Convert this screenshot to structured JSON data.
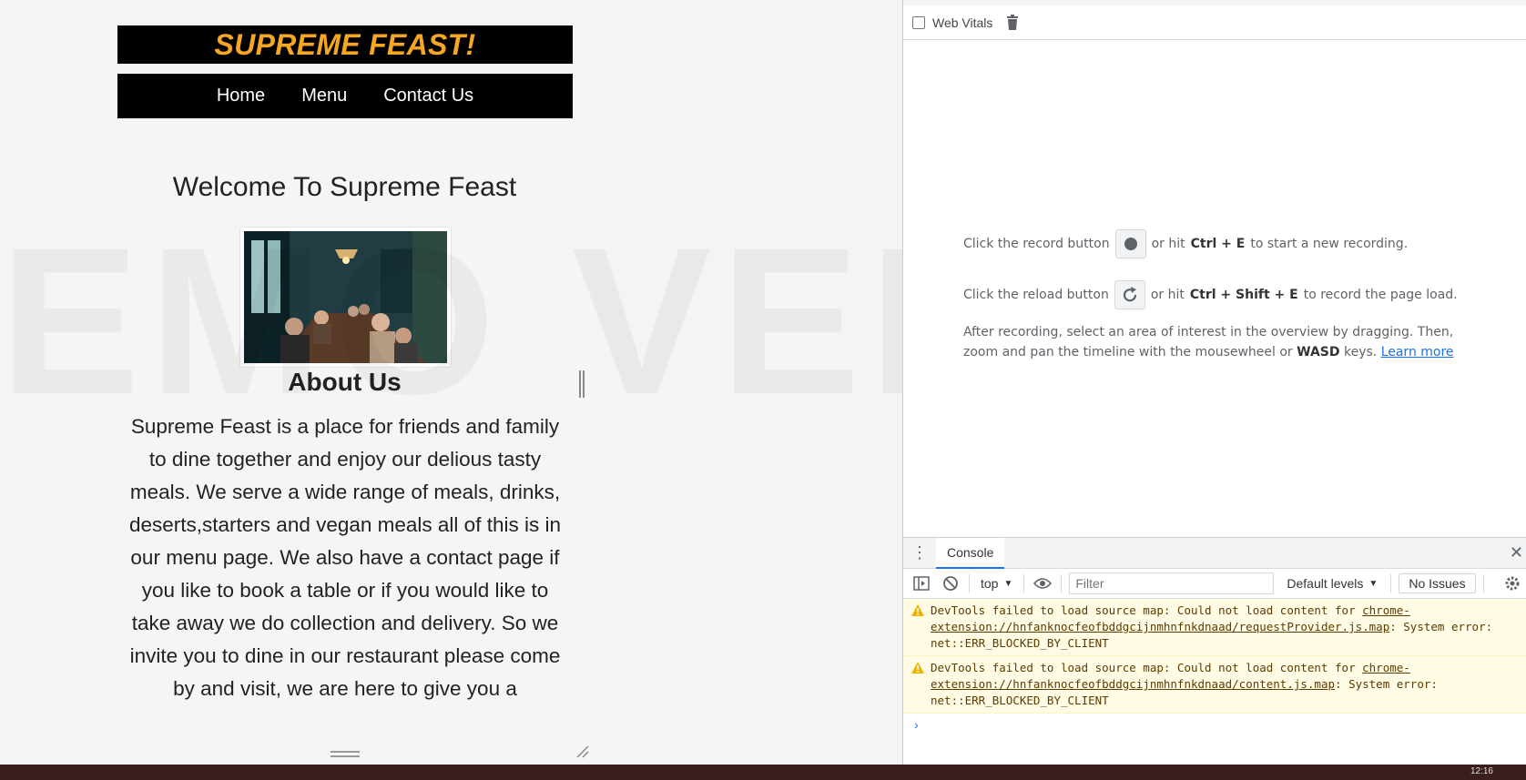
{
  "site": {
    "title": "SUPREME FEAST!",
    "nav": [
      "Home",
      "Menu",
      "Contact Us"
    ],
    "welcome": "Welcome To Supreme Feast",
    "about_title": "About Us",
    "about_text": "Supreme Feast is a place for friends and family to dine together and enjoy our delious tasty meals. We serve a wide range of meals, drinks, deserts,starters and vegan meals all of this is in our menu page. We also have a contact page if you like to book a table or if you would like to take away we do collection and delivery. So we invite you to dine in our restaurant please come by and visit, we are here to give you a"
  },
  "watermark": "EMO VERSION",
  "performance": {
    "web_vitals_label": "Web Vitals",
    "record_prefix": "Click the record button",
    "record_mid": "or hit",
    "record_keys": "Ctrl + E",
    "record_suffix": "to start a new recording.",
    "reload_prefix": "Click the reload button",
    "reload_mid": "or hit",
    "reload_keys": "Ctrl + Shift + E",
    "reload_suffix": "to record the page load.",
    "after_text_1": "After recording, select an area of interest in the overview by dragging. Then, zoom and pan the timeline with the mousewheel or",
    "after_keys": "WASD",
    "after_text_2": "keys.",
    "learn_more": "Learn more"
  },
  "console": {
    "tab_label": "Console",
    "context": "top",
    "filter_placeholder": "Filter",
    "levels": "Default levels",
    "issues": "No Issues",
    "messages": [
      {
        "prefix": "DevTools failed to load source map: Could not load content for ",
        "link": "chrome-extension://hnfanknocfeofbddgcijnmhnfnkdnaad/requestProvider.js.map",
        "suffix": ": System error: net::ERR_BLOCKED_BY_CLIENT"
      },
      {
        "prefix": "DevTools failed to load source map: Could not load content for ",
        "link": "chrome-extension://hnfanknocfeofbddgcijnmhnfnkdnaad/content.js.map",
        "suffix": ": System error: net::ERR_BLOCKED_BY_CLIENT"
      }
    ],
    "prompt": "›"
  },
  "taskbar": {
    "clock": "12:16"
  }
}
